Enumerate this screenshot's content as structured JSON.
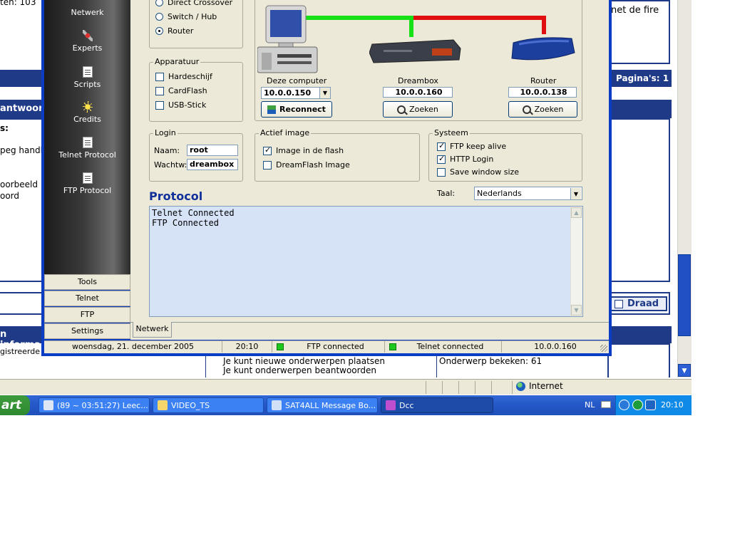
{
  "forum": {
    "top_left_text": "ten: 103",
    "reply_heading": "antwoor",
    "colon_text": "s:",
    "line_handl": "peg handl",
    "line_voorbeeld": "oorbeeld",
    "line_woord": "oord",
    "right_text": "net de fire",
    "pages_label": "Pagina's: 1",
    "info_heading": "n informa",
    "registered_text": "gistreerde",
    "info_line1": "Je kunt nieuwe onderwerpen plaatsen",
    "info_line2": "Je kunt onderwerpen beantwoorden",
    "topic_views": "Onderwerp bekeken: 61",
    "draad_button": "Draad"
  },
  "ie_status": {
    "zone": "Internet"
  },
  "taskbar": {
    "start_label": "art",
    "tasks": [
      {
        "label": "(89 ~ 03:51:27) Leec..."
      },
      {
        "label": "VIDEO_TS"
      },
      {
        "label": "SAT4ALL Message Bo..."
      },
      {
        "label": "Dcc"
      }
    ],
    "language": "NL",
    "clock": "20:10"
  },
  "sidebar": {
    "items": [
      {
        "label": "Netwerk",
        "icon": "network-icon"
      },
      {
        "label": "Experts",
        "icon": "tools-icon"
      },
      {
        "label": "Scripts",
        "icon": "document-icon"
      },
      {
        "label": "Credits",
        "icon": "star-icon"
      },
      {
        "label": "Telnet Protocol",
        "icon": "document-icon"
      },
      {
        "label": "FTP Protocol",
        "icon": "document-icon"
      }
    ],
    "buttons": [
      "Tools",
      "Telnet",
      "FTP",
      "Settings"
    ]
  },
  "connection": {
    "options": [
      "Direct Crossover",
      "Switch / Hub",
      "Router"
    ],
    "selected": "Router"
  },
  "apparatuur": {
    "title": "Apparatuur",
    "items": [
      {
        "label": "Hardeschijf",
        "checked": false
      },
      {
        "label": "CardFlash",
        "checked": false
      },
      {
        "label": "USB-Stick",
        "checked": false
      }
    ]
  },
  "devices": {
    "computer": {
      "label": "Deze computer",
      "ip": "10.0.0.150",
      "button": "Reconnect"
    },
    "dreambox": {
      "label": "Dreambox",
      "ip": "10.0.0.160",
      "button": "Zoeken"
    },
    "router": {
      "label": "Router",
      "ip": "10.0.0.138",
      "button": "Zoeken"
    },
    "line_colors": {
      "green": "#16e016",
      "red": "#e01010"
    }
  },
  "login": {
    "title": "Login",
    "name_label": "Naam:",
    "name_value": "root",
    "password_label": "Wachtw:",
    "password_value": "dreambox"
  },
  "actief_image": {
    "title": "Actief image",
    "items": [
      {
        "label": "Image in de flash",
        "checked": true
      },
      {
        "label": "DreamFlash Image",
        "checked": false
      }
    ]
  },
  "systeem": {
    "title": "Systeem",
    "items": [
      {
        "label": "FTP keep alive",
        "checked": true
      },
      {
        "label": "HTTP Login",
        "checked": true
      },
      {
        "label": "Save window size",
        "checked": false
      }
    ]
  },
  "language": {
    "label": "Taal:",
    "value": "Nederlands"
  },
  "protocol": {
    "title": "Protocol",
    "log": "Telnet Connected\nFTP Connected"
  },
  "tab": {
    "label": "Netwerk"
  },
  "status_bar": {
    "date": "woensdag, 21. december 2005",
    "time": "20:10",
    "ftp": "FTP connected",
    "telnet": "Telnet connected",
    "ip": "10.0.0.160"
  },
  "colors": {
    "title_blue": "#12309a",
    "window_blue": "#0a3cc4",
    "led_green": "#1ec81e"
  }
}
